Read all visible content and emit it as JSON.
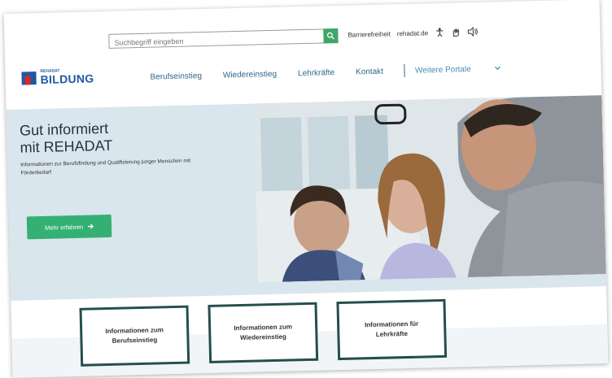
{
  "search": {
    "placeholder": "Suchbegriff eingeben"
  },
  "utility": {
    "barrierefreiheit": "Barrierefreiheit",
    "rehadat": "rehadat.de",
    "icons": [
      "accessibility-icon",
      "sign-language-icon",
      "speaker-icon"
    ]
  },
  "logo": {
    "small": "REHADAT",
    "big": "BILDUNG"
  },
  "nav": {
    "items": [
      "Berufseinstieg",
      "Wiedereinstieg",
      "Lehrkräfte",
      "Kontakt"
    ],
    "more": "Weitere Portale"
  },
  "hero": {
    "title_line1": "Gut informiert",
    "title_line2": "mit REHADAT",
    "subtitle": "Informationen zur Berufsfindung und Qualifizierung junger Menschen mit Förderbedarf",
    "cta": "Mehr erfahren"
  },
  "boxes": [
    {
      "line1": "Informationen zum",
      "line2": "Berufseinstieg"
    },
    {
      "line1": "Informationen zum",
      "line2": "Wiedereinstieg"
    },
    {
      "line1": "Informationen für",
      "line2": "Lehrkräfte"
    }
  ],
  "colors": {
    "accent_green": "#35b074",
    "brand_blue": "#1d5aa0",
    "hero_bg": "#d9e6ee",
    "box_border": "#244f4c"
  }
}
